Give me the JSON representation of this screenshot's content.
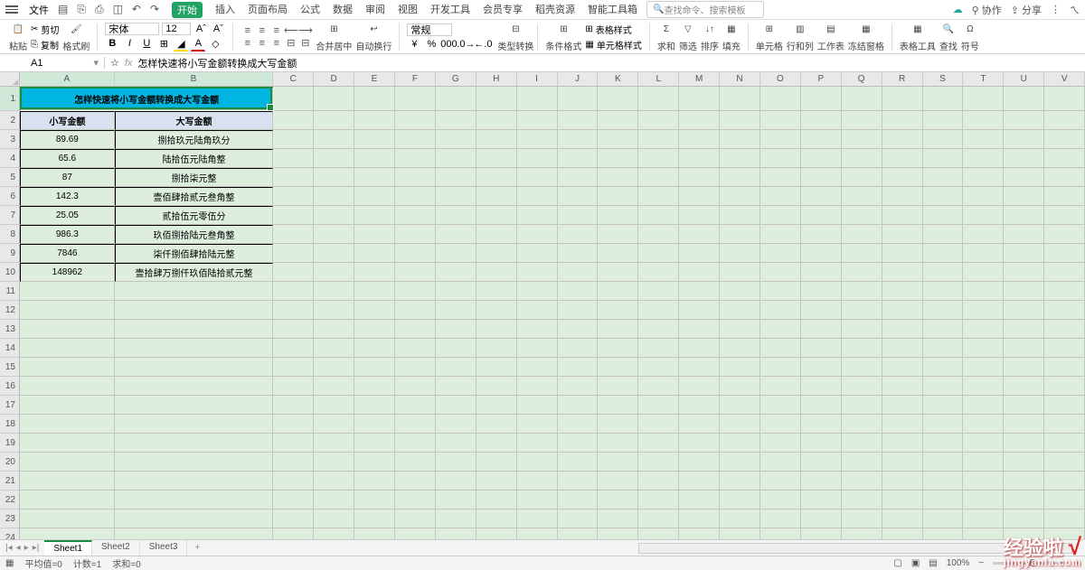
{
  "menu": {
    "file": "文件",
    "tabs": [
      "开始",
      "插入",
      "页面布局",
      "公式",
      "数据",
      "审阅",
      "视图",
      "开发工具",
      "会员专享",
      "稻壳资源",
      "智能工具箱"
    ],
    "search_placeholder": "查找命令、搜索模板",
    "collab": "协作",
    "share": "分享"
  },
  "ribbon": {
    "paste": "粘贴",
    "cut": "剪切",
    "copy": "复制",
    "format_painter": "格式刷",
    "font": "宋体",
    "size": "12",
    "merge": "合并居中",
    "autowrap": "自动换行",
    "general": "常规",
    "type_convert": "类型转换",
    "cond_fmt": "条件格式",
    "table_style": "表格样式",
    "cell_style": "单元格样式",
    "sum": "求和",
    "filter": "筛选",
    "sort": "排序",
    "fill": "填充",
    "cells": "单元格",
    "rowcol": "行和列",
    "sheet": "工作表",
    "freeze": "冻结窗格",
    "table_tool": "表格工具",
    "find": "查找",
    "symbol": "符号"
  },
  "formula_bar": {
    "cell": "A1",
    "content": "怎样快速将小写金额转换成大写金额"
  },
  "columns": [
    "A",
    "B",
    "C",
    "D",
    "E",
    "F",
    "G",
    "H",
    "I",
    "J",
    "K",
    "L",
    "M",
    "N",
    "O",
    "P",
    "Q",
    "R",
    "S",
    "T",
    "U",
    "V"
  ],
  "col_widths": {
    "A": 105,
    "B": 176,
    "other": 45
  },
  "chart_data": {
    "type": "table",
    "title": "怎样快速将小写金额转换成大写金额",
    "headers": [
      "小写金额",
      "大写金额"
    ],
    "rows": [
      [
        "89.69",
        "捌拾玖元陆角玖分"
      ],
      [
        "65.6",
        "陆拾伍元陆角整"
      ],
      [
        "87",
        "捌拾柒元整"
      ],
      [
        "142.3",
        "壹佰肆拾贰元叁角整"
      ],
      [
        "25.05",
        "贰拾伍元零伍分"
      ],
      [
        "986.3",
        "玖佰捌拾陆元叁角整"
      ],
      [
        "7846",
        "柒仟捌佰肆拾陆元整"
      ],
      [
        "148962",
        "壹拾肆万捌仟玖佰陆拾贰元整"
      ]
    ]
  },
  "sheets": [
    "Sheet1",
    "Sheet2",
    "Sheet3"
  ],
  "status": {
    "avg": "平均值=0",
    "count": "计数=1",
    "sum": "求和=0",
    "zoom": "100%"
  },
  "watermark": {
    "top": "经验啦",
    "bottom": "jingyanla.com"
  }
}
